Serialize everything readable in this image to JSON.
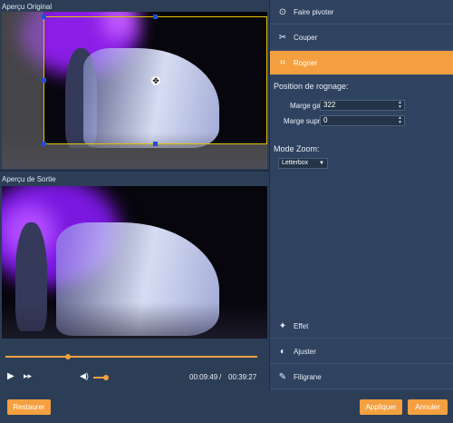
{
  "original_preview": {
    "label": "Aperçu Original"
  },
  "output_preview": {
    "label": "Aperçu de Sortie"
  },
  "player": {
    "current_time": "00:09:49",
    "separator": "/",
    "total_time": "00:39:27",
    "progress": 0.25,
    "volume": 0.6
  },
  "icons": {
    "play": "play-icon",
    "forward": "fast-forward-icon",
    "volume": "volume-icon"
  },
  "menu": {
    "rotate": "Faire pivoter",
    "cut": "Couper",
    "crop": "Rogner",
    "effect": "Effet",
    "adjust": "Ajuster",
    "watermark": "Filigrane"
  },
  "crop": {
    "position_title": "Position de rognage:",
    "left_margin_label": "Marge gauche:",
    "left_margin_value": "322",
    "top_margin_label": "Marge suprême:",
    "top_margin_value": "0"
  },
  "zoom": {
    "title": "Mode Zoom:",
    "selected": "Letterbox"
  },
  "buttons": {
    "restore": "Restaurer",
    "apply": "Appliquer",
    "cancel": "Annuler"
  },
  "colors": {
    "accent": "#f5a040",
    "panel": "#2f4360",
    "crop_border": "#e0c200",
    "handle": "#1e4fd8"
  }
}
